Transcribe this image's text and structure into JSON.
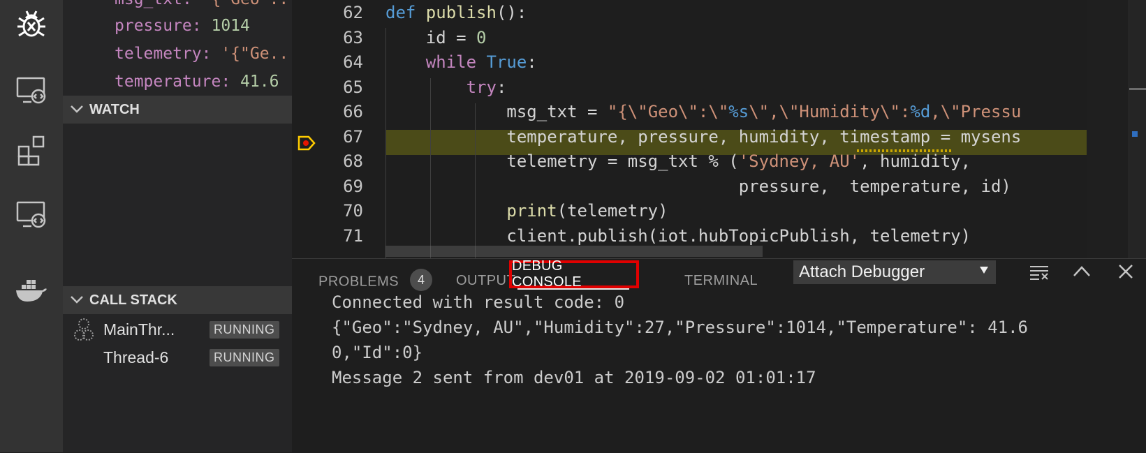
{
  "side": {
    "variables": [
      {
        "key": "msg_txt",
        "sep": ": ",
        "value": "'{\"Geo\"...",
        "type": "str"
      },
      {
        "key": "pressure",
        "sep": ": ",
        "value": "1014",
        "type": "num"
      },
      {
        "key": "telemetry",
        "sep": ": ",
        "value": "'{\"Ge...",
        "type": "str"
      },
      {
        "key": "temperature",
        "sep": ": ",
        "value": "41.6",
        "type": "num"
      }
    ],
    "watch_title": "WATCH",
    "callstack_title": "CALL STACK",
    "threads": [
      {
        "name": "MainThr...",
        "state": "RUNNING"
      },
      {
        "name": "Thread-6",
        "state": "RUNNING"
      }
    ]
  },
  "editor": {
    "line_numbers": [
      "62",
      "63",
      "64",
      "65",
      "66",
      "67",
      "68",
      "69",
      "70",
      "71"
    ],
    "lines": [
      [
        {
          "t": "def ",
          "c": "kw"
        },
        {
          "t": "publish",
          "c": "fn"
        },
        {
          "t": "():",
          "c": ""
        }
      ],
      [
        {
          "t": "    id = ",
          "c": ""
        },
        {
          "t": "0",
          "c": "num"
        }
      ],
      [
        {
          "t": "    ",
          "c": ""
        },
        {
          "t": "while ",
          "c": "ctl"
        },
        {
          "t": "True",
          "c": "kw"
        },
        {
          "t": ":",
          "c": ""
        }
      ],
      [
        {
          "t": "        ",
          "c": ""
        },
        {
          "t": "try",
          "c": "ctl"
        },
        {
          "t": ":",
          "c": ""
        }
      ],
      [
        {
          "t": "            msg_txt = ",
          "c": ""
        },
        {
          "t": "\"{\\\"Geo\\\":\\\"",
          "c": "str"
        },
        {
          "t": "%s",
          "c": "kw"
        },
        {
          "t": "\\\",\\\"Humidity\\\":",
          "c": "str"
        },
        {
          "t": "%d",
          "c": "kw"
        },
        {
          "t": ",\\\"Pressu",
          "c": "str"
        }
      ],
      [
        {
          "t": "            temperature, pressure, humidity, timestamp = mysens",
          "c": ""
        }
      ],
      [
        {
          "t": "            telemetry = msg_txt % (",
          "c": ""
        },
        {
          "t": "'Sydney, AU'",
          "c": "str"
        },
        {
          "t": ", humidity,",
          "c": ""
        }
      ],
      [
        {
          "t": "                                   pressure,  temperature, id)",
          "c": ""
        }
      ],
      [
        {
          "t": "            ",
          "c": ""
        },
        {
          "t": "print",
          "c": "fn"
        },
        {
          "t": "(telemetry)",
          "c": ""
        }
      ],
      [
        {
          "t": "            client.publish(iot.hubTopicPublish, telemetry)",
          "c": ""
        }
      ]
    ]
  },
  "panel": {
    "tabs": {
      "problems": "PROBLEMS",
      "problems_count": "4",
      "output": "OUTPUT",
      "debug_console": "DEBUG CONSOLE",
      "terminal": "TERMINAL"
    },
    "dropdown_value": "Attach Debugger",
    "console_lines": [
      "Connected with result code: 0",
      "{\"Geo\":\"Sydney, AU\",\"Humidity\":27,\"Pressure\":1014,\"Temperature\": 41.6",
      "0,\"Id\":0}",
      "Message 2 sent from dev01 at 2019-09-02 01:01:17"
    ]
  },
  "colors": {
    "accent_highlight": "#e00000",
    "breakpoint": "#ffcc00",
    "current_line_bg": "#4b4b18"
  },
  "icons": [
    "debug-icon",
    "remote-explorer-icon",
    "extensions-icon",
    "remote-explorer-icon-2",
    "docker-icon",
    "breakpoint-stopped-icon",
    "chevron-down-icon",
    "clear-console-icon",
    "chevron-up-icon",
    "close-icon"
  ]
}
